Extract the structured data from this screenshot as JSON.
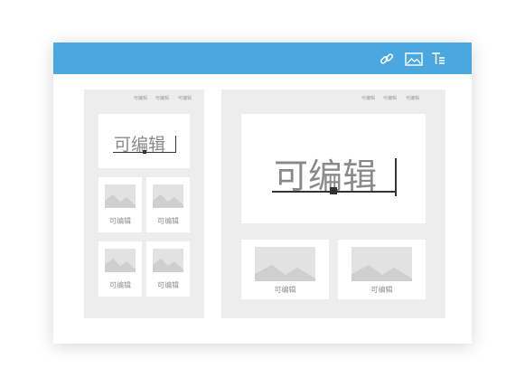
{
  "toolbar": {
    "link_icon": "link-icon",
    "image_icon": "image-icon",
    "text_icon": "text-format-icon",
    "color": "#4aa8de"
  },
  "left_template": {
    "labels": [
      "可编辑",
      "可编辑",
      "可编辑"
    ],
    "title_text": "可编辑",
    "tiles": [
      {
        "caption": "可编辑"
      },
      {
        "caption": "可编辑"
      },
      {
        "caption": "可编辑"
      },
      {
        "caption": "可编辑"
      }
    ]
  },
  "right_template": {
    "labels": [
      "可编辑",
      "可编辑",
      "可编辑"
    ],
    "title_text": "可编辑",
    "tiles": [
      {
        "caption": "可编辑"
      },
      {
        "caption": "可编辑"
      }
    ]
  }
}
